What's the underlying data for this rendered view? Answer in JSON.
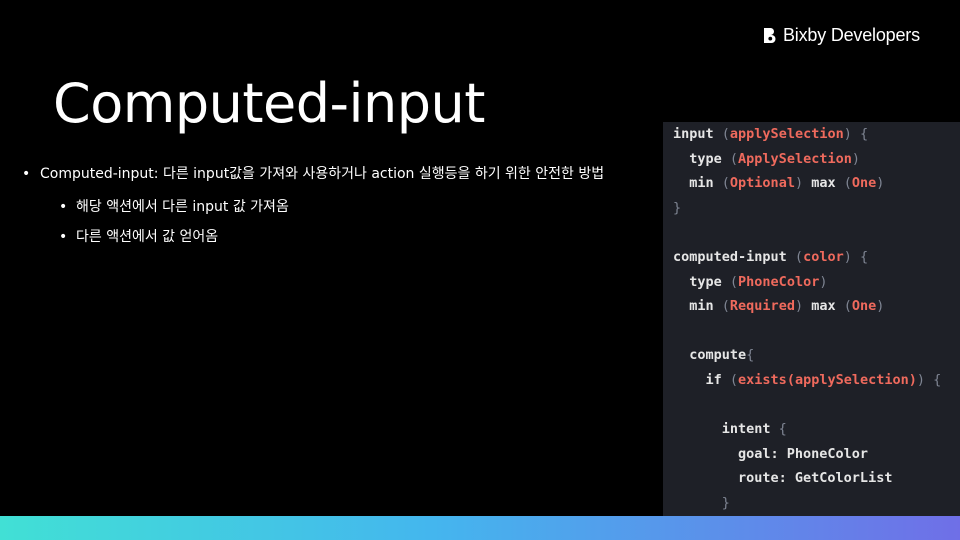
{
  "brand": {
    "logo_icon": "bixby-b-icon",
    "label": "Bixby Developers"
  },
  "slide": {
    "title": "Computed-input",
    "bullets": [
      {
        "text": "Computed-input: 다른 input값을 가져와 사용하거나 action 실행등을 하기 위한 안전한 방법",
        "sub": [
          "해당 액션에서 다른 input 값 가져옴",
          "다른 액션에서 값 얻어옴"
        ]
      }
    ]
  },
  "code": {
    "lines": [
      [
        {
          "t": "input ",
          "c": "plain"
        },
        {
          "t": "(",
          "c": "paren"
        },
        {
          "t": "applySelection",
          "c": "val"
        },
        {
          "t": ")",
          "c": "paren"
        },
        {
          "t": " ",
          "c": "plain"
        },
        {
          "t": "{",
          "c": "paren"
        }
      ],
      [
        {
          "t": "  type ",
          "c": "plain"
        },
        {
          "t": "(",
          "c": "paren"
        },
        {
          "t": "ApplySelection",
          "c": "val"
        },
        {
          "t": ")",
          "c": "paren"
        }
      ],
      [
        {
          "t": "  min ",
          "c": "plain"
        },
        {
          "t": "(",
          "c": "paren"
        },
        {
          "t": "Optional",
          "c": "val"
        },
        {
          "t": ")",
          "c": "paren"
        },
        {
          "t": " max ",
          "c": "plain"
        },
        {
          "t": "(",
          "c": "paren"
        },
        {
          "t": "One",
          "c": "val"
        },
        {
          "t": ")",
          "c": "paren"
        }
      ],
      [
        {
          "t": "}",
          "c": "paren"
        }
      ],
      [],
      [
        {
          "t": "computed-input ",
          "c": "plain"
        },
        {
          "t": "(",
          "c": "paren"
        },
        {
          "t": "color",
          "c": "val"
        },
        {
          "t": ")",
          "c": "paren"
        },
        {
          "t": " ",
          "c": "plain"
        },
        {
          "t": "{",
          "c": "paren"
        }
      ],
      [
        {
          "t": "  type ",
          "c": "plain"
        },
        {
          "t": "(",
          "c": "paren"
        },
        {
          "t": "PhoneColor",
          "c": "val"
        },
        {
          "t": ")",
          "c": "paren"
        }
      ],
      [
        {
          "t": "  min ",
          "c": "plain"
        },
        {
          "t": "(",
          "c": "paren"
        },
        {
          "t": "Required",
          "c": "val"
        },
        {
          "t": ")",
          "c": "paren"
        },
        {
          "t": " max ",
          "c": "plain"
        },
        {
          "t": "(",
          "c": "paren"
        },
        {
          "t": "One",
          "c": "val"
        },
        {
          "t": ")",
          "c": "paren"
        }
      ],
      [],
      [
        {
          "t": "  compute",
          "c": "plain"
        },
        {
          "t": "{",
          "c": "paren"
        }
      ],
      [
        {
          "t": "    if ",
          "c": "plain"
        },
        {
          "t": "(",
          "c": "paren"
        },
        {
          "t": "exists(applySelection)",
          "c": "val"
        },
        {
          "t": ")",
          "c": "paren"
        },
        {
          "t": " ",
          "c": "plain"
        },
        {
          "t": "{",
          "c": "paren"
        }
      ],
      [],
      [
        {
          "t": "      intent ",
          "c": "plain"
        },
        {
          "t": "{",
          "c": "paren"
        }
      ],
      [
        {
          "t": "        goal: PhoneColor",
          "c": "plain"
        }
      ],
      [
        {
          "t": "        route: GetColorList",
          "c": "plain"
        }
      ],
      [
        {
          "t": "      }",
          "c": "paren"
        }
      ]
    ]
  },
  "colors": {
    "background": "#000000",
    "code_panel": "#1e2027",
    "code_text": "#e6e6e6",
    "code_value": "#ef6a5d",
    "code_paren": "#7f8593",
    "footer_gradient": [
      "#41e0d5",
      "#44b6ee",
      "#6f6fe7"
    ]
  }
}
